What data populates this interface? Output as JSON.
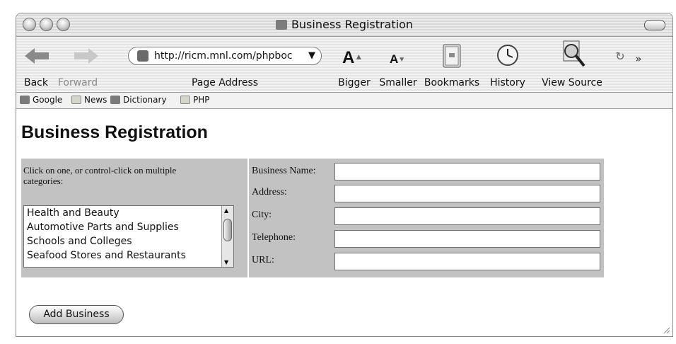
{
  "window": {
    "title": "Business Registration"
  },
  "toolbar": {
    "back_label": "Back",
    "forward_label": "Forward",
    "address_url": "http://ricm.mnl.com/phpboc",
    "address_label": "Page Address",
    "bigger_label": "Bigger",
    "smaller_label": "Smaller",
    "bookmarks_label": "Bookmarks",
    "history_label": "History",
    "view_source_label": "View Source"
  },
  "bookmarks_bar": {
    "items": [
      {
        "label": "Google",
        "icon": "site-icon"
      },
      {
        "label": "News",
        "icon": "folder-icon"
      },
      {
        "label": "Dictionary",
        "icon": "site-icon"
      },
      {
        "label": "PHP",
        "icon": "folder-icon"
      }
    ]
  },
  "page": {
    "heading": "Business Registration",
    "category_instructions": "Click on one, or control-click on multiple categories:",
    "categories": [
      "Health and Beauty",
      "Automotive Parts and Supplies",
      "Schools and Colleges",
      "Seafood Stores and Restaurants"
    ],
    "fields": [
      {
        "label": "Business Name:",
        "value": ""
      },
      {
        "label": "Address:",
        "value": ""
      },
      {
        "label": "City:",
        "value": ""
      },
      {
        "label": "Telephone:",
        "value": ""
      },
      {
        "label": "URL:",
        "value": ""
      }
    ],
    "submit_label": "Add Business"
  }
}
